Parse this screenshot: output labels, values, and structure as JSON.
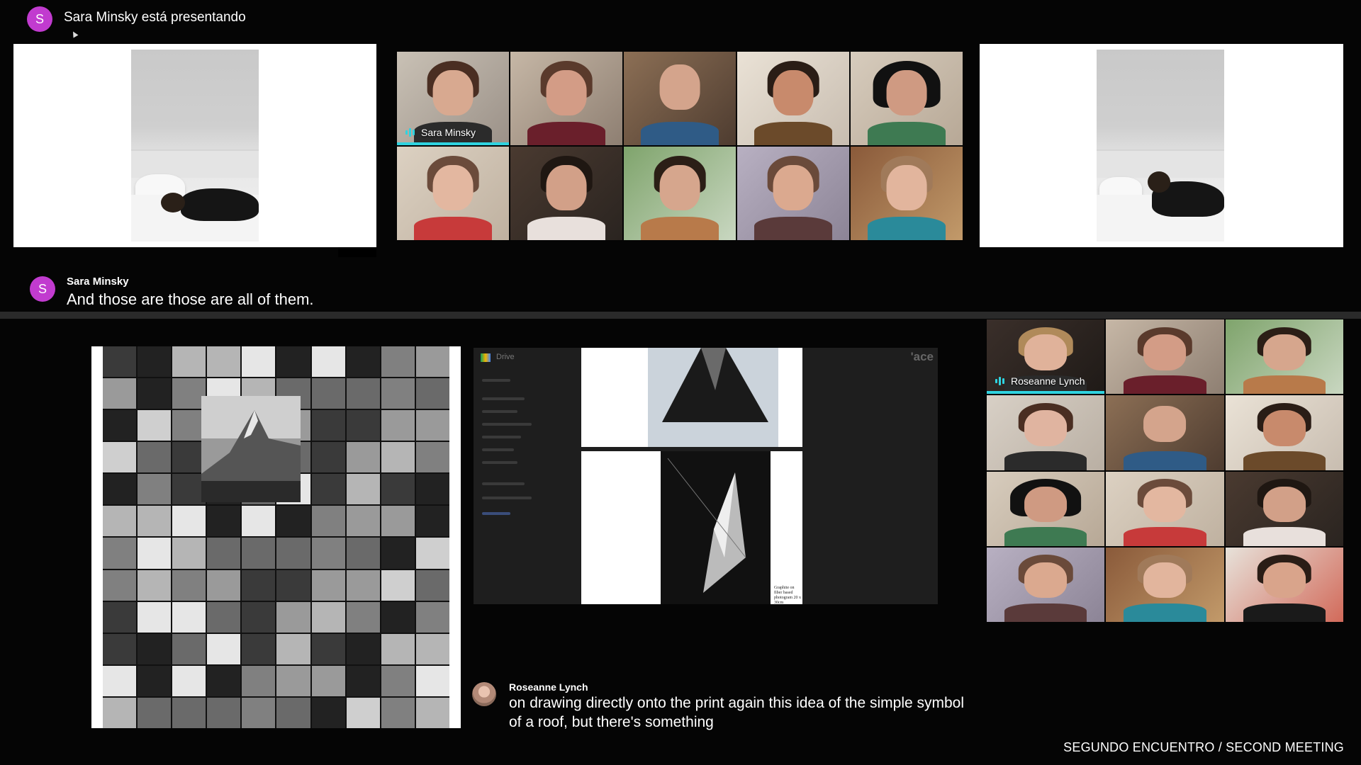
{
  "presenter": {
    "avatar_letter": "S",
    "presenting_label": "Sara Minsky está presentando"
  },
  "top_grid": {
    "tiles": [
      {
        "label": "Sara Minsky",
        "speaking": true
      },
      {
        "label": ""
      },
      {
        "label": ""
      },
      {
        "label": ""
      },
      {
        "label": ""
      },
      {
        "label": ""
      },
      {
        "label": ""
      },
      {
        "label": ""
      },
      {
        "label": ""
      },
      {
        "label": ""
      }
    ]
  },
  "top_caption": {
    "avatar_letter": "S",
    "name": "Sara Minsky",
    "text": "And those are those are all of them."
  },
  "drive_window": {
    "app_name": "Drive",
    "brand_fragment": "'ace",
    "caption": "Graphite on fiber based photogram 20 x 30cm"
  },
  "bottom_grid": {
    "tiles": [
      {
        "label": "Roseanne Lynch",
        "speaking": true
      },
      {
        "label": ""
      },
      {
        "label": ""
      },
      {
        "label": ""
      },
      {
        "label": ""
      },
      {
        "label": ""
      },
      {
        "label": ""
      },
      {
        "label": ""
      },
      {
        "label": ""
      },
      {
        "label": ""
      },
      {
        "label": ""
      },
      {
        "label": ""
      }
    ]
  },
  "bottom_caption": {
    "name": "Roseanne Lynch",
    "line1": "on drawing directly onto the print again this idea of the simple symbol",
    "line2": "of a roof, but there's something"
  },
  "footer": {
    "title": "SEGUNDO ENCUENTRO / SECOND MEETING"
  },
  "colors": {
    "avatar": "#c13bcf",
    "speaking": "#2fd3e0",
    "background": "#050505"
  }
}
